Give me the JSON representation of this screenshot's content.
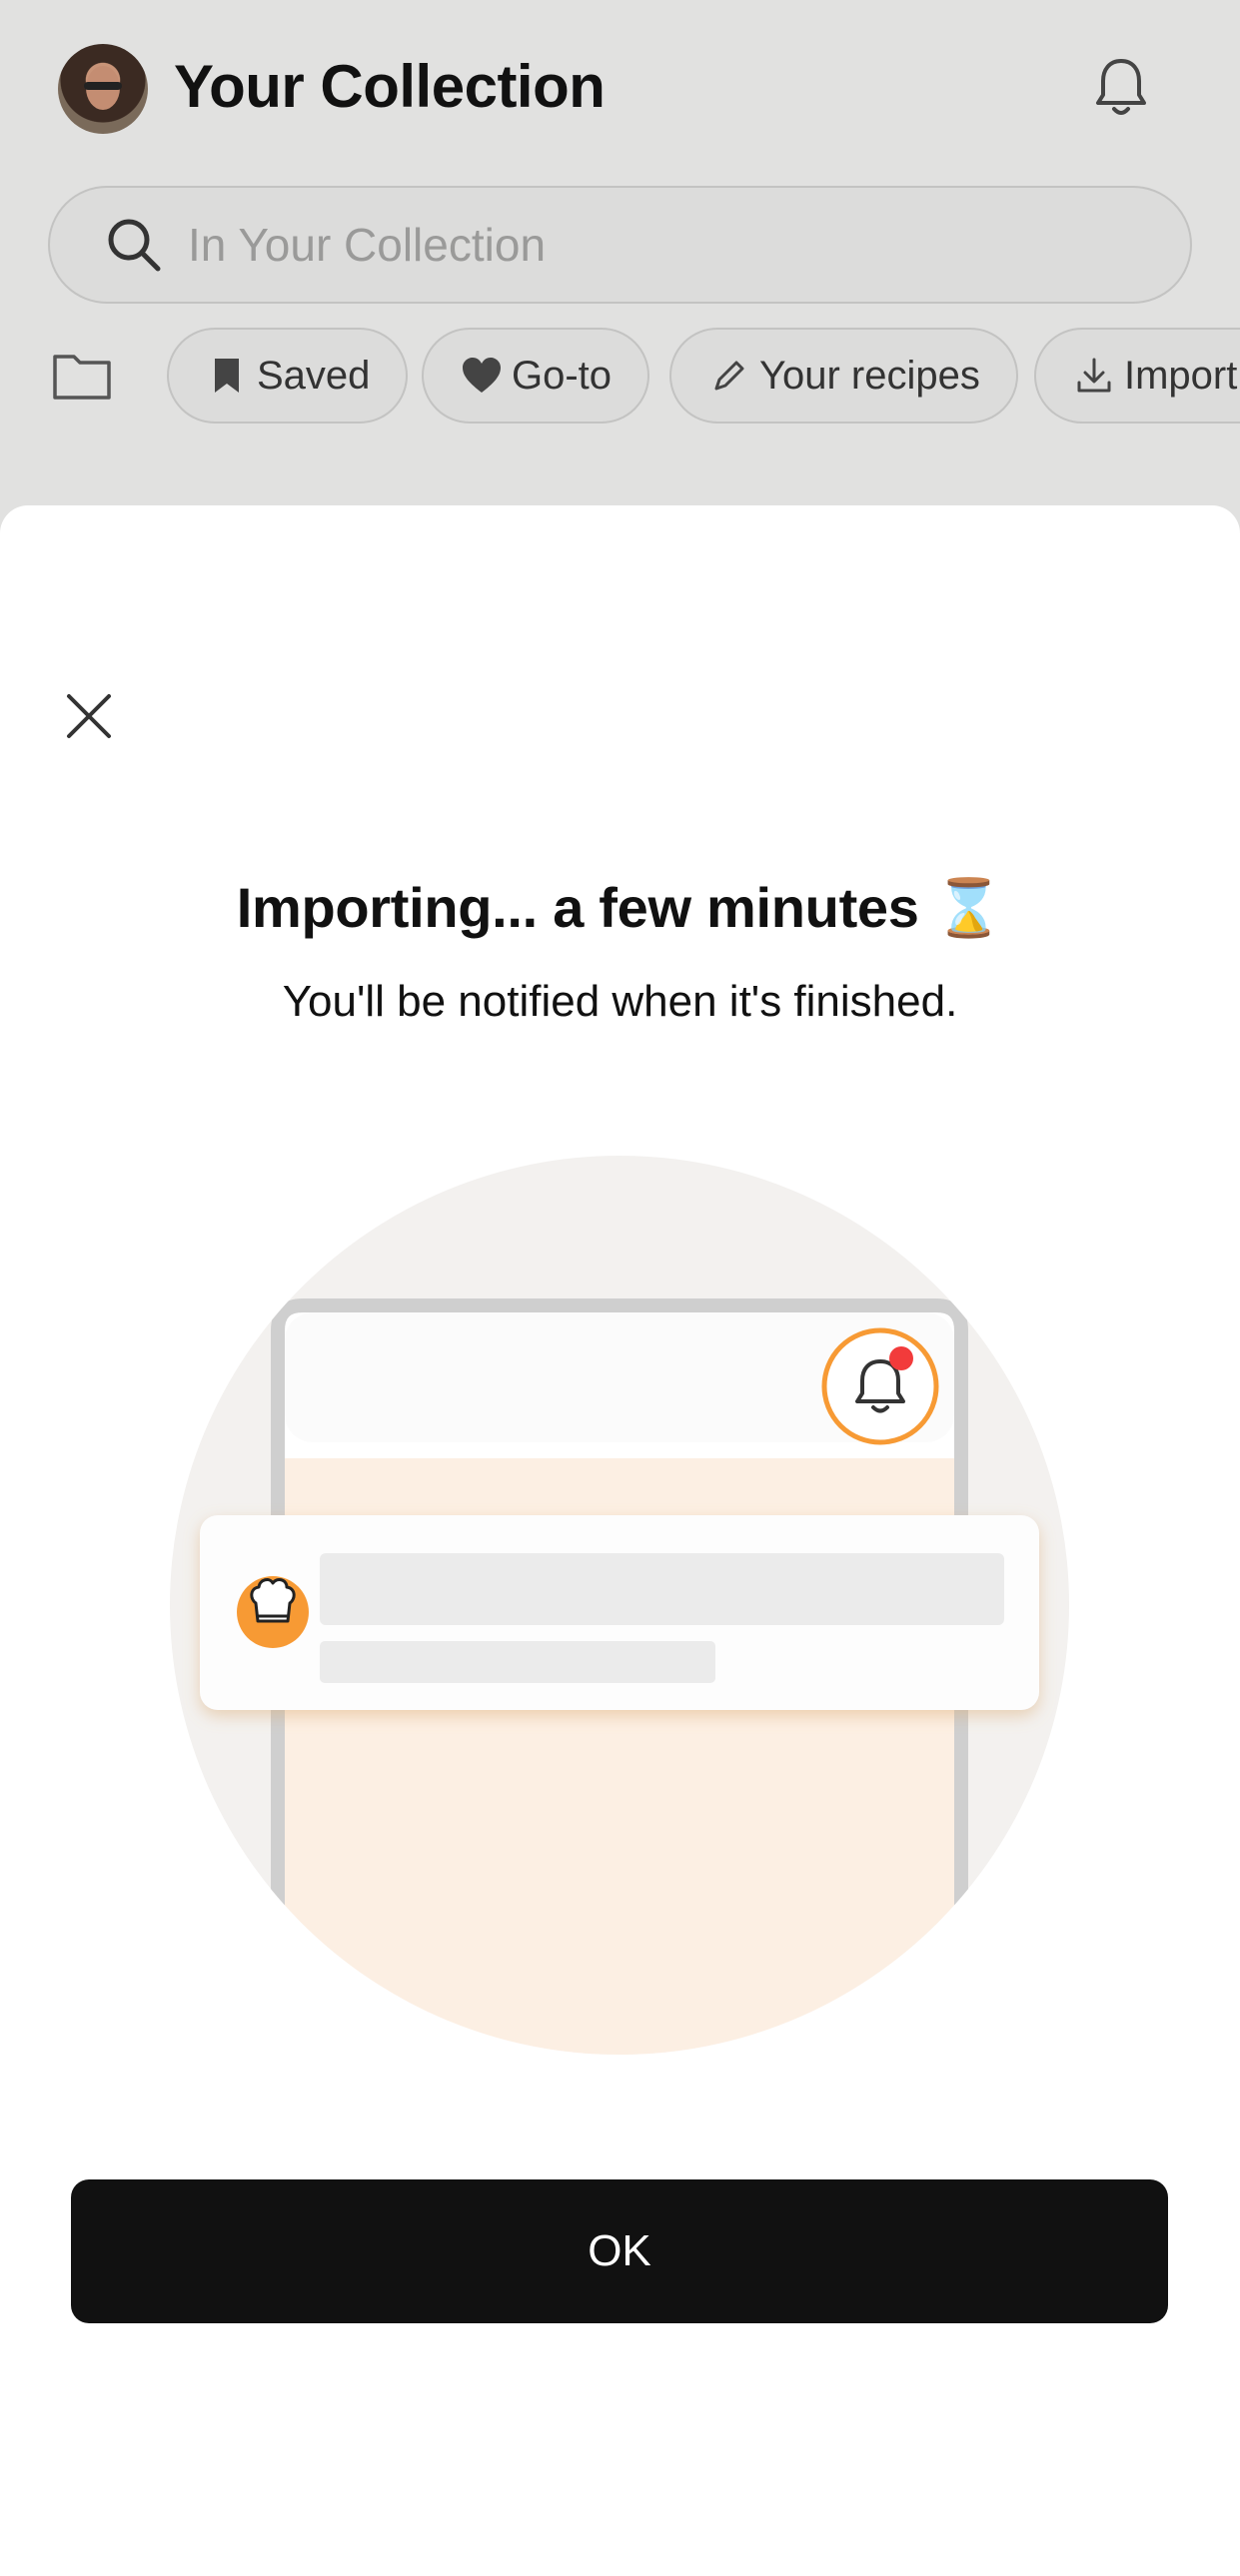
{
  "header": {
    "title": "Your Collection"
  },
  "search": {
    "placeholder": "In Your Collection"
  },
  "chips": [
    {
      "label": "Saved",
      "icon": "bookmark-icon"
    },
    {
      "label": "Go-to",
      "icon": "heart-icon"
    },
    {
      "label": "Your recipes",
      "icon": "pencil-icon"
    },
    {
      "label": "Import",
      "icon": "download-icon"
    }
  ],
  "modal": {
    "title": "Importing... a few minutes ⌛",
    "subtitle": "You'll be notified when it's finished.",
    "ok_label": "OK"
  },
  "colors": {
    "accent": "#F79A34",
    "notification_dot": "#F23B3B",
    "button_bg": "#111111",
    "backdrop": "#E1E1E0"
  }
}
